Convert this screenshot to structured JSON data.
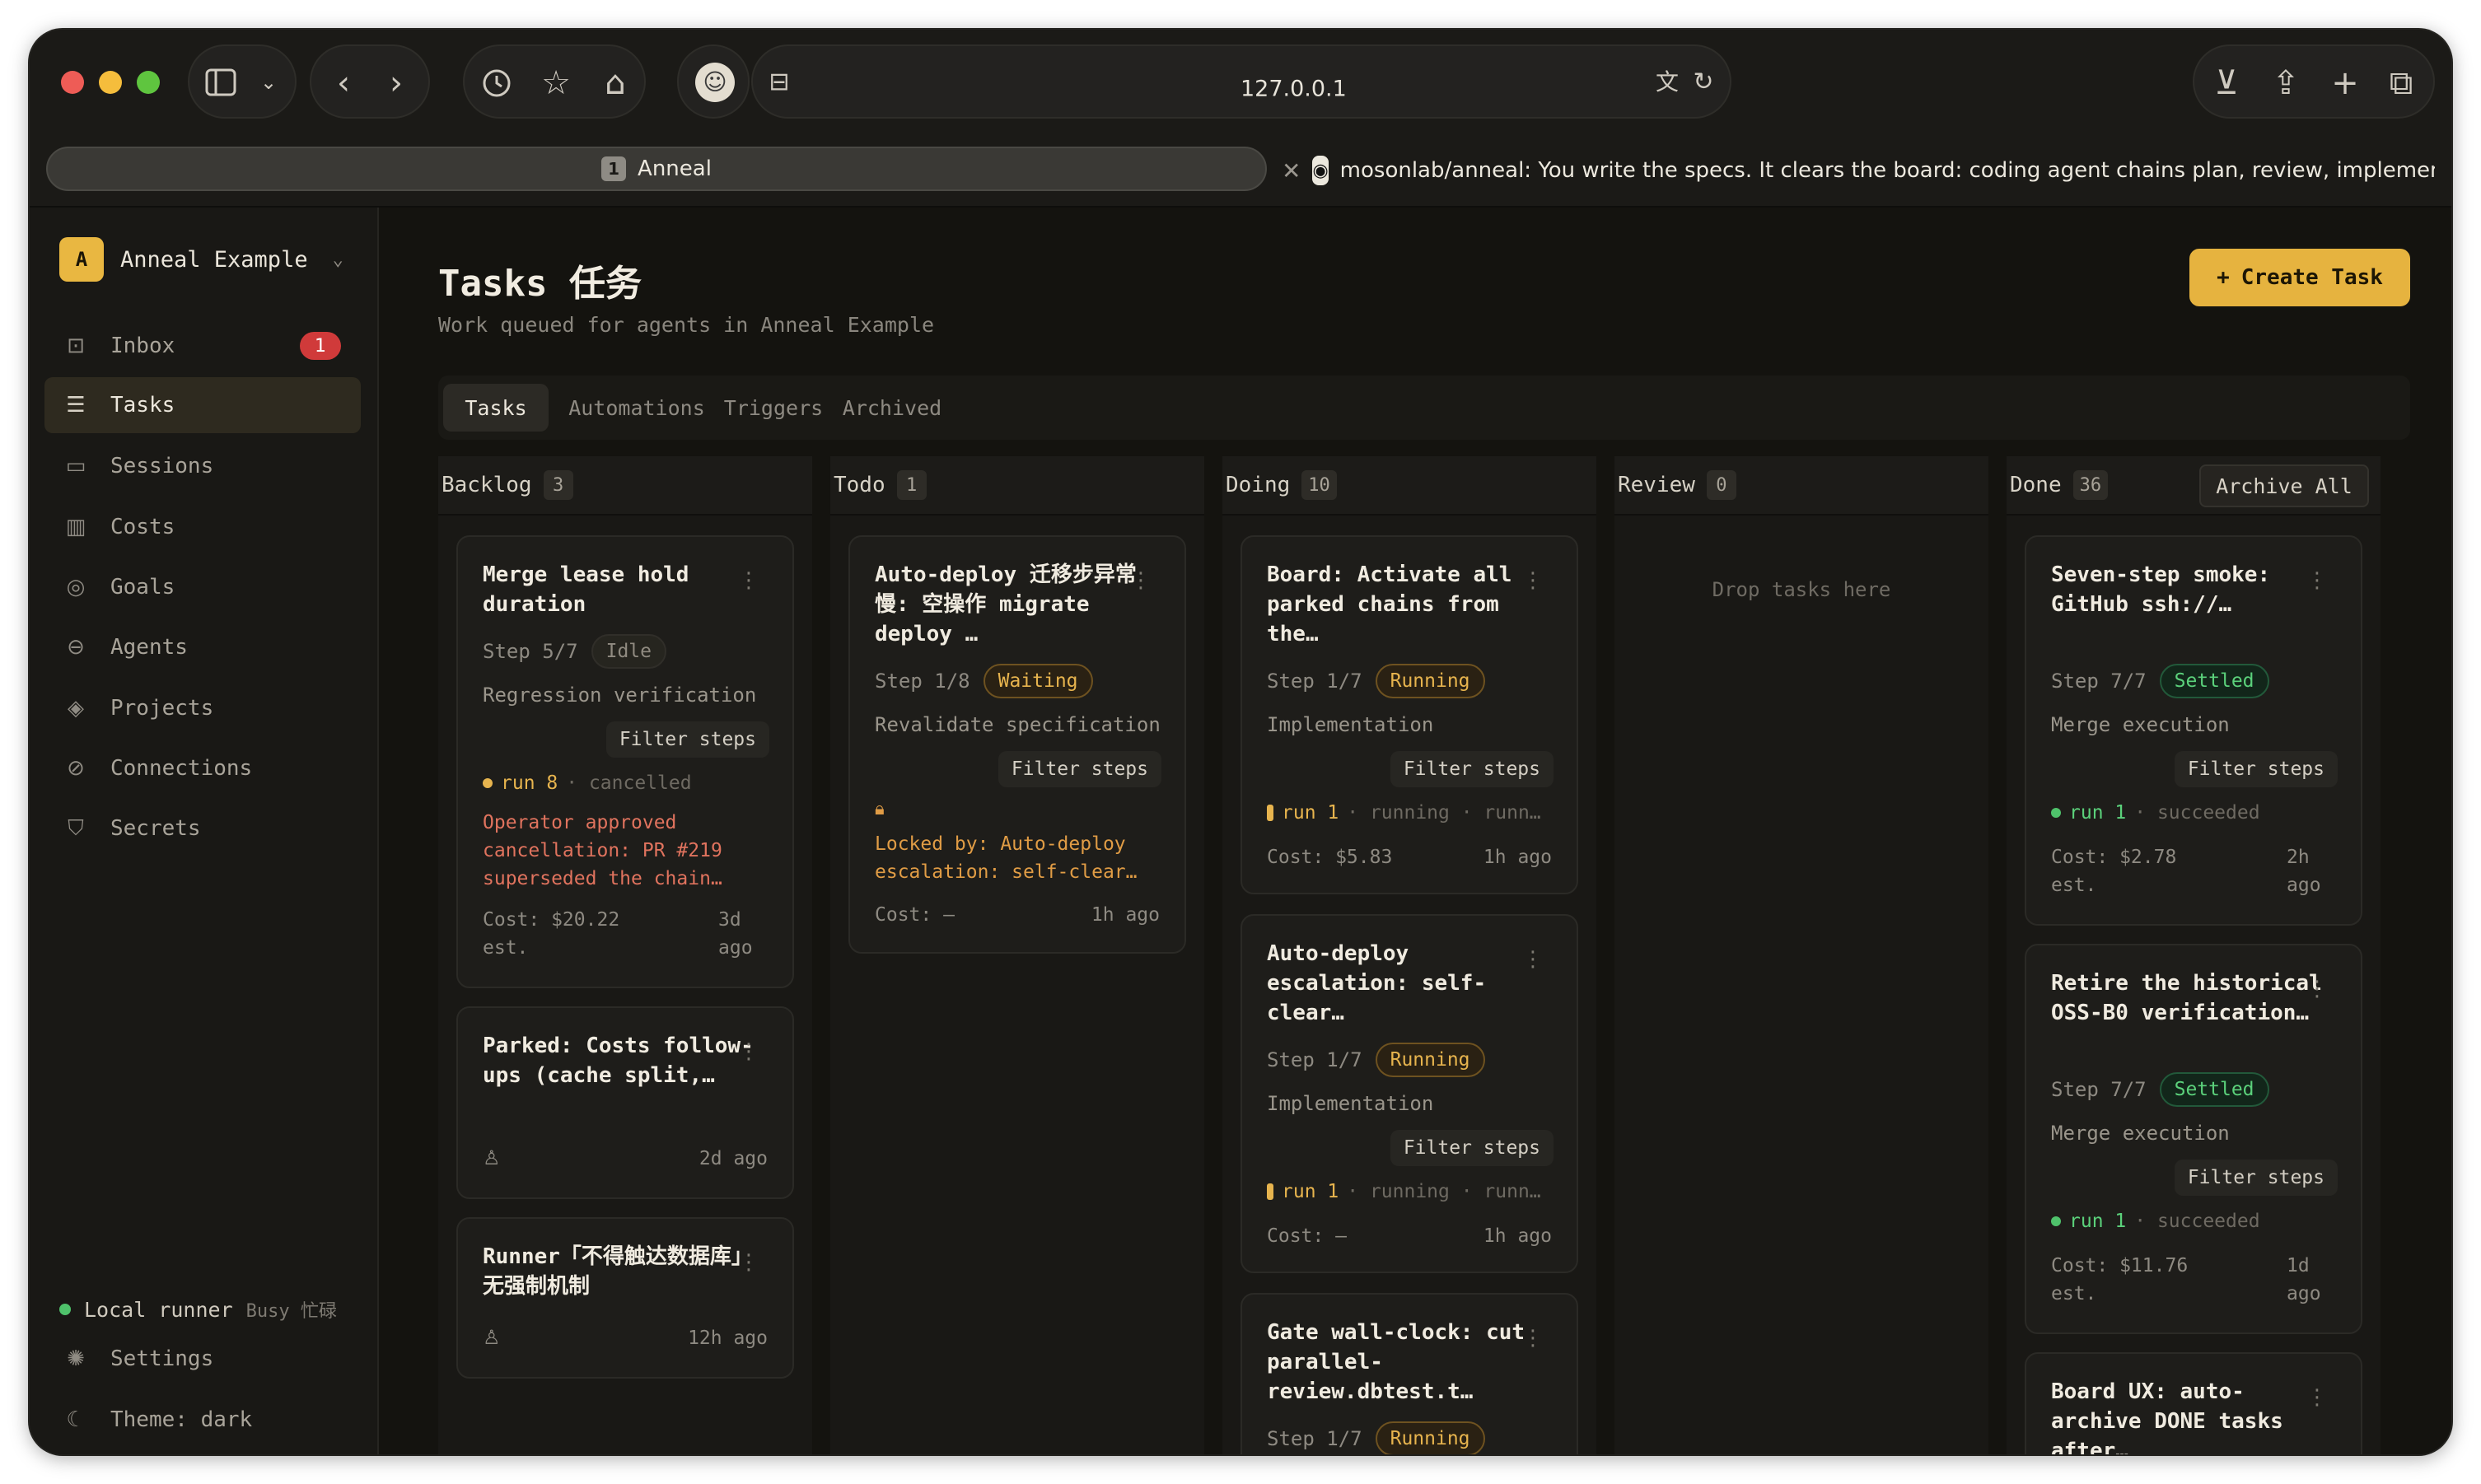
{
  "browser": {
    "url": "127.0.0.1",
    "tabs": [
      {
        "num": "1",
        "title": "Anneal"
      },
      {
        "title": "mosonlab/anneal: You write the specs. It clears the board: coding agent chains plan, review, implement, verif..."
      }
    ]
  },
  "sidebar": {
    "workspace": {
      "initial": "A",
      "name": "Anneal Example"
    },
    "items": [
      {
        "label": "Inbox",
        "icon": "inbox-icon",
        "badge": "1"
      },
      {
        "label": "Tasks",
        "icon": "list-icon"
      },
      {
        "label": "Sessions",
        "icon": "chat-icon"
      },
      {
        "label": "Costs",
        "icon": "bar-chart-icon"
      },
      {
        "label": "Goals",
        "icon": "target-icon"
      },
      {
        "label": "Agents",
        "icon": "robot-icon"
      },
      {
        "label": "Projects",
        "icon": "layers-icon"
      },
      {
        "label": "Connections",
        "icon": "link-icon"
      },
      {
        "label": "Secrets",
        "icon": "shield-icon"
      }
    ],
    "runner": {
      "label": "Local runner",
      "status": "Busy 忙碌"
    },
    "settings": "Settings",
    "theme": "Theme: dark"
  },
  "page": {
    "title": "Tasks 任务",
    "subtitle": "Work queued for agents in Anneal Example",
    "create_button": "Create Task",
    "view_tabs": [
      "Tasks",
      "Automations",
      "Triggers",
      "Archived"
    ]
  },
  "board": {
    "columns": [
      {
        "name": "Backlog",
        "count": "3"
      },
      {
        "name": "Todo",
        "count": "1"
      },
      {
        "name": "Doing",
        "count": "10"
      },
      {
        "name": "Review",
        "count": "0",
        "empty_text": "Drop tasks here"
      },
      {
        "name": "Done",
        "count": "36",
        "action": "Archive All"
      }
    ],
    "backlog": [
      {
        "title": "Merge lease hold duration",
        "step": "Step 5/7",
        "status": "Idle",
        "phase": "Regression verification",
        "filter": "Filter steps",
        "run": "run 8",
        "run_state": "· cancelled",
        "note": "Operator approved cancellation: PR #219 superseded the chain…",
        "cost": "Cost: $20.22 est.",
        "ago": "3d ago"
      },
      {
        "title": "Parked: Costs follow-ups (cache split,…",
        "ago": "2d ago"
      },
      {
        "title": "Runner「不得触达数据库」无强制机制",
        "ago": "12h ago"
      }
    ],
    "todo": [
      {
        "title": "Auto-deploy 迁移步异常慢: 空操作 migrate deploy …",
        "step": "Step 1/8",
        "status": "Waiting",
        "phase": "Revalidate specification",
        "filter": "Filter steps",
        "locked": "Locked by: Auto-deploy escalation: self-clear…",
        "cost": "Cost: —",
        "ago": "1h ago"
      }
    ],
    "doing": [
      {
        "title": "Board: Activate all parked chains from the…",
        "step": "Step 1/7",
        "status": "Running",
        "phase": "Implementation",
        "filter": "Filter steps",
        "run": "run 1",
        "run_state": "· running · runn…",
        "cost": "Cost: $5.83",
        "ago": "1h ago"
      },
      {
        "title": "Auto-deploy escalation: self-clear…",
        "step": "Step 1/7",
        "status": "Running",
        "phase": "Implementation",
        "filter": "Filter steps",
        "run": "run 1",
        "run_state": "· running · runn…",
        "cost": "Cost: —",
        "ago": "1h ago"
      },
      {
        "title": "Gate wall-clock: cut parallel-review.dbtest.t…",
        "step": "Step 1/7",
        "status": "Running"
      }
    ],
    "done": [
      {
        "title": "Seven-step smoke: GitHub ssh://…",
        "step": "Step 7/7",
        "status": "Settled",
        "phase": "Merge execution",
        "filter": "Filter steps",
        "run": "run 1",
        "run_state": "· succeeded",
        "cost": "Cost: $2.78 est.",
        "ago": "2h ago"
      },
      {
        "title": "Retire the historical OSS-B0 verification…",
        "step": "Step 7/7",
        "status": "Settled",
        "phase": "Merge execution",
        "filter": "Filter steps",
        "run": "run 1",
        "run_state": "· succeeded",
        "cost": "Cost: $11.76 est.",
        "ago": "1d ago"
      },
      {
        "title": "Board UX: auto-archive DONE tasks after…"
      }
    ]
  },
  "colors": {
    "accent": "#e6b33f",
    "running": "#e7b44e",
    "settled": "#5bd17b",
    "danger": "#d03a3a"
  }
}
